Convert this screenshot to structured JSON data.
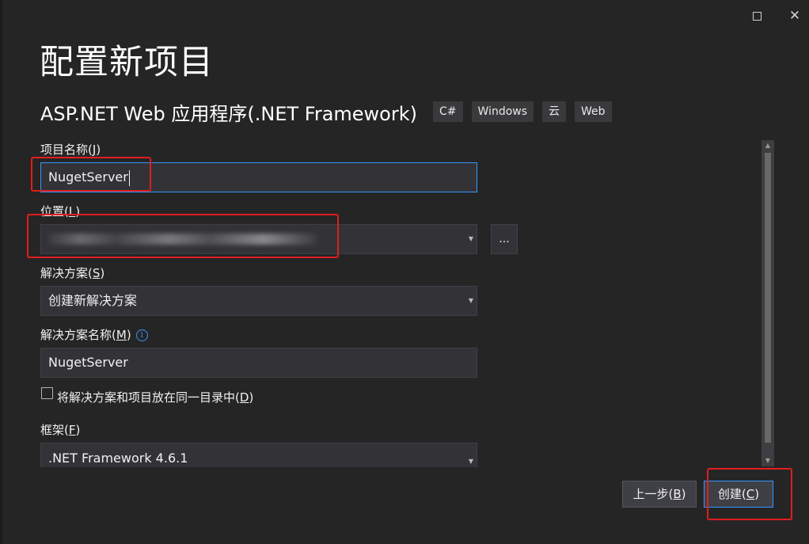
{
  "window": {
    "maximize_glyph": "square-icon",
    "close_glyph": "✕"
  },
  "page_title": "配置新项目",
  "template": {
    "name": "ASP.NET Web 应用程序(.NET Framework)",
    "tags": [
      "C#",
      "Windows",
      "云",
      "Web"
    ]
  },
  "fields": {
    "project_name": {
      "label": "项目名称",
      "accel": "J",
      "value": "NugetServer"
    },
    "location": {
      "label": "位置",
      "accel": "L",
      "value_note": "blurred",
      "browse": "..."
    },
    "solution": {
      "label": "解决方案",
      "accel": "S",
      "value": "创建新解决方案"
    },
    "solution_name": {
      "label": "解决方案名称",
      "accel": "M",
      "value": "NugetServer"
    },
    "same_dir": {
      "label": "将解决方案和项目放在同一目录中",
      "accel": "D",
      "checked": false
    },
    "framework": {
      "label": "框架",
      "accel": "F",
      "value": ".NET Framework 4.6.1"
    }
  },
  "buttons": {
    "back": {
      "label": "上一步",
      "accel": "B"
    },
    "create": {
      "label": "创建",
      "accel": "C"
    }
  },
  "colors": {
    "accent": "#3399ff",
    "highlight": "#e01e1e"
  }
}
